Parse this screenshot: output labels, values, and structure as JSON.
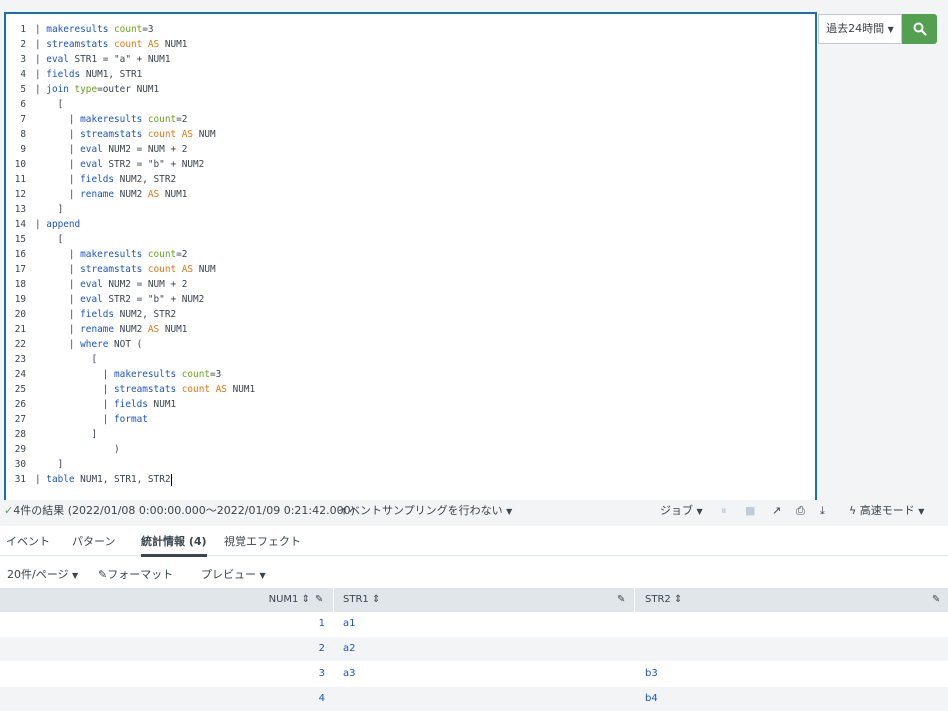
{
  "editor": {
    "lines": [
      [
        {
          "t": "| ",
          "c": "st"
        },
        {
          "t": "makeresults",
          "c": "kw"
        },
        {
          "t": " count",
          "c": "arg"
        },
        {
          "t": "=3",
          "c": "st"
        }
      ],
      [
        {
          "t": "| ",
          "c": "st"
        },
        {
          "t": "streamstats",
          "c": "kw"
        },
        {
          "t": " count",
          "c": "as"
        },
        {
          "t": " AS",
          "c": "as"
        },
        {
          "t": " NUM1",
          "c": "st"
        }
      ],
      [
        {
          "t": "| ",
          "c": "st"
        },
        {
          "t": "eval",
          "c": "kw"
        },
        {
          "t": " STR1 = \"a\" + NUM1",
          "c": "st"
        }
      ],
      [
        {
          "t": "| ",
          "c": "st"
        },
        {
          "t": "fields",
          "c": "kw"
        },
        {
          "t": " NUM1, STR1",
          "c": "st"
        }
      ],
      [
        {
          "t": "| ",
          "c": "st"
        },
        {
          "t": "join",
          "c": "kw"
        },
        {
          "t": " type",
          "c": "arg"
        },
        {
          "t": "=outer NUM1",
          "c": "st"
        }
      ],
      [
        {
          "t": "    [",
          "c": "st"
        }
      ],
      [
        {
          "t": "      | ",
          "c": "st"
        },
        {
          "t": "makeresults",
          "c": "kw"
        },
        {
          "t": " count",
          "c": "arg"
        },
        {
          "t": "=2",
          "c": "st"
        }
      ],
      [
        {
          "t": "      | ",
          "c": "st"
        },
        {
          "t": "streamstats",
          "c": "kw"
        },
        {
          "t": " count",
          "c": "as"
        },
        {
          "t": " AS",
          "c": "as"
        },
        {
          "t": " NUM",
          "c": "st"
        }
      ],
      [
        {
          "t": "      | ",
          "c": "st"
        },
        {
          "t": "eval",
          "c": "kw"
        },
        {
          "t": " NUM2 = NUM + 2",
          "c": "st"
        }
      ],
      [
        {
          "t": "      | ",
          "c": "st"
        },
        {
          "t": "eval",
          "c": "kw"
        },
        {
          "t": " STR2 = \"b\" + NUM2",
          "c": "st"
        }
      ],
      [
        {
          "t": "      | ",
          "c": "st"
        },
        {
          "t": "fields",
          "c": "kw"
        },
        {
          "t": " NUM2, STR2",
          "c": "st"
        }
      ],
      [
        {
          "t": "      | ",
          "c": "st"
        },
        {
          "t": "rename",
          "c": "kw"
        },
        {
          "t": " NUM2",
          "c": "st"
        },
        {
          "t": " AS",
          "c": "as"
        },
        {
          "t": " NUM1",
          "c": "st"
        }
      ],
      [
        {
          "t": "    ]",
          "c": "st"
        }
      ],
      [
        {
          "t": "| ",
          "c": "st"
        },
        {
          "t": "append",
          "c": "kw"
        }
      ],
      [
        {
          "t": "    [",
          "c": "st"
        }
      ],
      [
        {
          "t": "      | ",
          "c": "st"
        },
        {
          "t": "makeresults",
          "c": "kw"
        },
        {
          "t": " count",
          "c": "arg"
        },
        {
          "t": "=2",
          "c": "st"
        }
      ],
      [
        {
          "t": "      | ",
          "c": "st"
        },
        {
          "t": "streamstats",
          "c": "kw"
        },
        {
          "t": " count",
          "c": "as"
        },
        {
          "t": " AS",
          "c": "as"
        },
        {
          "t": " NUM",
          "c": "st"
        }
      ],
      [
        {
          "t": "      | ",
          "c": "st"
        },
        {
          "t": "eval",
          "c": "kw"
        },
        {
          "t": " NUM2 = NUM + 2",
          "c": "st"
        }
      ],
      [
        {
          "t": "      | ",
          "c": "st"
        },
        {
          "t": "eval",
          "c": "kw"
        },
        {
          "t": " STR2 = \"b\" + NUM2",
          "c": "st"
        }
      ],
      [
        {
          "t": "      | ",
          "c": "st"
        },
        {
          "t": "fields",
          "c": "kw"
        },
        {
          "t": " NUM2, STR2",
          "c": "st"
        }
      ],
      [
        {
          "t": "      | ",
          "c": "st"
        },
        {
          "t": "rename",
          "c": "kw"
        },
        {
          "t": " NUM2",
          "c": "st"
        },
        {
          "t": " AS",
          "c": "as"
        },
        {
          "t": " NUM1",
          "c": "st"
        }
      ],
      [
        {
          "t": "      | ",
          "c": "st"
        },
        {
          "t": "where",
          "c": "kw"
        },
        {
          "t": " NOT (",
          "c": "st"
        }
      ],
      [
        {
          "t": "          [",
          "c": "st"
        }
      ],
      [
        {
          "t": "            | ",
          "c": "st"
        },
        {
          "t": "makeresults",
          "c": "kw"
        },
        {
          "t": " count",
          "c": "arg"
        },
        {
          "t": "=3",
          "c": "st"
        }
      ],
      [
        {
          "t": "            | ",
          "c": "st"
        },
        {
          "t": "streamstats",
          "c": "kw"
        },
        {
          "t": " count",
          "c": "as"
        },
        {
          "t": " AS",
          "c": "as"
        },
        {
          "t": " NUM1",
          "c": "st"
        }
      ],
      [
        {
          "t": "            | ",
          "c": "st"
        },
        {
          "t": "fields",
          "c": "kw"
        },
        {
          "t": " NUM1",
          "c": "st"
        }
      ],
      [
        {
          "t": "            | ",
          "c": "st"
        },
        {
          "t": "format",
          "c": "kw"
        }
      ],
      [
        {
          "t": "          ]",
          "c": "st"
        }
      ],
      [
        {
          "t": "              )",
          "c": "st"
        }
      ],
      [
        {
          "t": "    ]",
          "c": "st"
        }
      ],
      [
        {
          "t": "| ",
          "c": "st"
        },
        {
          "t": "table",
          "c": "kw"
        },
        {
          "t": " NUM1, STR1, STR2",
          "c": "st"
        }
      ]
    ]
  },
  "time_picker": {
    "label": "過去24時間"
  },
  "search_button": {
    "icon": "search-icon"
  },
  "status": {
    "result_text": "4件の結果 (2022/01/08 0:00:00.000〜2022/01/09 0:21:42.000)",
    "sampling": "イベントサンプリングを行わない",
    "job": "ジョブ",
    "mode": "高速モード"
  },
  "tabs": [
    "イベント",
    "パターン",
    "統計情報 (4)",
    "視覚エフェクト"
  ],
  "toolbar": {
    "per_page": "20件/ページ",
    "format": "フォーマット",
    "preview": "プレビュー"
  },
  "table": {
    "columns": [
      "NUM1",
      "STR1",
      "STR2"
    ],
    "rows": [
      [
        "1",
        "a1",
        ""
      ],
      [
        "2",
        "a2",
        ""
      ],
      [
        "3",
        "a3",
        "b3"
      ],
      [
        "4",
        "",
        "b4"
      ]
    ]
  },
  "colors": {
    "accent": "#1a6fb0",
    "search_green": "#53a051",
    "keyword": "#1a55c8",
    "argument": "#6ba31b",
    "as_orange": "#e6750f"
  }
}
